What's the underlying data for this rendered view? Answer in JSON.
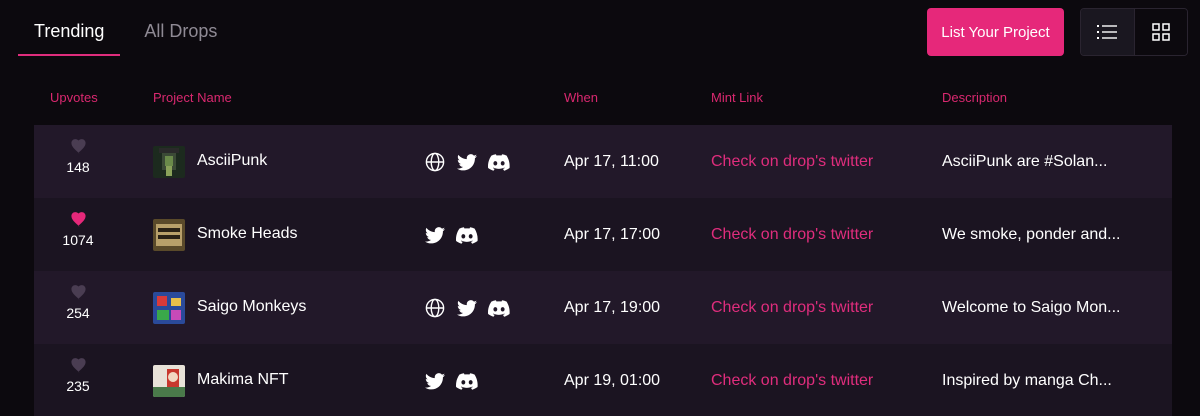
{
  "tabs": [
    {
      "label": "Trending",
      "active": true
    },
    {
      "label": "All Drops",
      "active": false
    }
  ],
  "actions": {
    "list_project": "List Your Project",
    "view_list_icon": "list-icon",
    "view_grid_icon": "grid-icon"
  },
  "columns": {
    "upvotes": "Upvotes",
    "project_name": "Project Name",
    "when": "When",
    "mint_link": "Mint Link",
    "description": "Description"
  },
  "projects": [
    {
      "upvotes": "148",
      "liked": false,
      "name": "AsciiPunk",
      "links": [
        "globe-icon",
        "twitter-icon",
        "discord-icon"
      ],
      "when": "Apr 17, 11:00",
      "mint": "Check on drop's twitter",
      "description": "AsciiPunk are #Solan..."
    },
    {
      "upvotes": "1074",
      "liked": true,
      "name": "Smoke Heads",
      "links": [
        "twitter-icon",
        "discord-icon"
      ],
      "when": "Apr 17, 17:00",
      "mint": "Check on drop's twitter",
      "description": "We smoke, ponder and..."
    },
    {
      "upvotes": "254",
      "liked": false,
      "name": "Saigo Monkeys",
      "links": [
        "globe-icon",
        "twitter-icon",
        "discord-icon"
      ],
      "when": "Apr 17, 19:00",
      "mint": "Check on drop's twitter",
      "description": "Welcome to Saigo Mon..."
    },
    {
      "upvotes": "235",
      "liked": false,
      "name": "Makima NFT",
      "links": [
        "twitter-icon",
        "discord-icon"
      ],
      "when": "Apr 19, 01:00",
      "mint": "Check on drop's twitter",
      "description": "Inspired by manga Ch..."
    }
  ],
  "colors": {
    "accent": "#e6287a",
    "heart_active": "#e6287a",
    "heart_inactive": "#4a3d52"
  }
}
